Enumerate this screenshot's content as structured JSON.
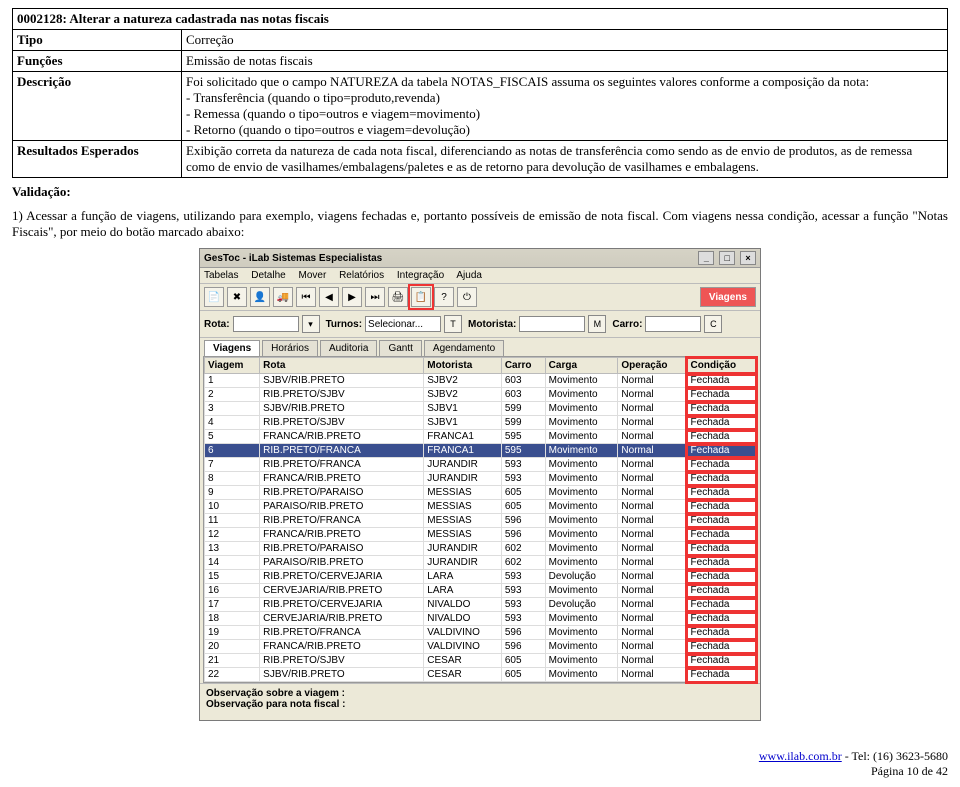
{
  "meta": {
    "titleRow": "0002128: Alterar a natureza cadastrada nas notas fiscais",
    "tipoLabel": "Tipo",
    "tipoValue": "Correção",
    "funcoesLabel": "Funções",
    "funcoesValue": "Emissão de notas fiscais",
    "descricaoLabel": "Descrição",
    "descIntro": "Foi solicitado que o campo NATUREZA da tabela NOTAS_FISCAIS assuma os seguintes valores conforme a composição da nota:",
    "descL1": "- Transferência (quando o tipo=produto,revenda)",
    "descL2": "- Remessa (quando o tipo=outros e viagem=movimento)",
    "descL3": "- Retorno (quando o tipo=outros e viagem=devolução)",
    "resultadosLabel": "Resultados Esperados",
    "resultadosValue": "Exibição correta da natureza de cada nota fiscal, diferenciando as notas de transferência como sendo as de envio de produtos, as de remessa como de envio de vasilhames/embalagens/paletes e as de retorno para devolução de vasilhames e embalagens."
  },
  "validation": {
    "head": "Validação:",
    "text": "1) Acessar a função de viagens, utilizando para exemplo, viagens fechadas e, portanto possíveis de emissão de nota fiscal. Com viagens nessa condição, acessar a função \"Notas Fiscais\", por meio do botão marcado abaixo:"
  },
  "shot": {
    "title": "GesToc - iLab Sistemas Especialistas",
    "menus": [
      "Tabelas",
      "Detalhe",
      "Mover",
      "Relatórios",
      "Integração",
      "Ajuda"
    ],
    "toolbarRight": "Viagens",
    "filters": {
      "rotaLabel": "Rota:",
      "turnosLabel": "Turnos:",
      "turnosValue": "Selecionar...",
      "motoristaLabel": "Motorista:",
      "carroLabel": "Carro:"
    },
    "tabs": [
      "Viagens",
      "Horários",
      "Auditoria",
      "Gantt",
      "Agendamento"
    ],
    "headers": [
      "Viagem",
      "Rota",
      "Motorista",
      "Carro",
      "Carga",
      "Operação",
      "Condição"
    ],
    "rows": [
      [
        "1",
        "SJBV/RIB.PRETO",
        "SJBV2",
        "603",
        "Movimento",
        "Normal",
        "Fechada"
      ],
      [
        "2",
        "RIB.PRETO/SJBV",
        "SJBV2",
        "603",
        "Movimento",
        "Normal",
        "Fechada"
      ],
      [
        "3",
        "SJBV/RIB.PRETO",
        "SJBV1",
        "599",
        "Movimento",
        "Normal",
        "Fechada"
      ],
      [
        "4",
        "RIB.PRETO/SJBV",
        "SJBV1",
        "599",
        "Movimento",
        "Normal",
        "Fechada"
      ],
      [
        "5",
        "FRANCA/RIB.PRETO",
        "FRANCA1",
        "595",
        "Movimento",
        "Normal",
        "Fechada"
      ],
      [
        "6",
        "RIB.PRETO/FRANCA",
        "FRANCA1",
        "595",
        "Movimento",
        "Normal",
        "Fechada"
      ],
      [
        "7",
        "RIB.PRETO/FRANCA",
        "JURANDIR",
        "593",
        "Movimento",
        "Normal",
        "Fechada"
      ],
      [
        "8",
        "FRANCA/RIB.PRETO",
        "JURANDIR",
        "593",
        "Movimento",
        "Normal",
        "Fechada"
      ],
      [
        "9",
        "RIB.PRETO/PARAISO",
        "MESSIAS",
        "605",
        "Movimento",
        "Normal",
        "Fechada"
      ],
      [
        "10",
        "PARAISO/RIB.PRETO",
        "MESSIAS",
        "605",
        "Movimento",
        "Normal",
        "Fechada"
      ],
      [
        "11",
        "RIB.PRETO/FRANCA",
        "MESSIAS",
        "596",
        "Movimento",
        "Normal",
        "Fechada"
      ],
      [
        "12",
        "FRANCA/RIB.PRETO",
        "MESSIAS",
        "596",
        "Movimento",
        "Normal",
        "Fechada"
      ],
      [
        "13",
        "RIB.PRETO/PARAISO",
        "JURANDIR",
        "602",
        "Movimento",
        "Normal",
        "Fechada"
      ],
      [
        "14",
        "PARAISO/RIB.PRETO",
        "JURANDIR",
        "602",
        "Movimento",
        "Normal",
        "Fechada"
      ],
      [
        "15",
        "RIB.PRETO/CERVEJARIA",
        "LARA",
        "593",
        "Devolução",
        "Normal",
        "Fechada"
      ],
      [
        "16",
        "CERVEJARIA/RIB.PRETO",
        "LARA",
        "593",
        "Movimento",
        "Normal",
        "Fechada"
      ],
      [
        "17",
        "RIB.PRETO/CERVEJARIA",
        "NIVALDO",
        "593",
        "Devolução",
        "Normal",
        "Fechada"
      ],
      [
        "18",
        "CERVEJARIA/RIB.PRETO",
        "NIVALDO",
        "593",
        "Movimento",
        "Normal",
        "Fechada"
      ],
      [
        "19",
        "RIB.PRETO/FRANCA",
        "VALDIVINO",
        "596",
        "Movimento",
        "Normal",
        "Fechada"
      ],
      [
        "20",
        "FRANCA/RIB.PRETO",
        "VALDIVINO",
        "596",
        "Movimento",
        "Normal",
        "Fechada"
      ],
      [
        "21",
        "RIB.PRETO/SJBV",
        "CESAR",
        "605",
        "Movimento",
        "Normal",
        "Fechada"
      ],
      [
        "22",
        "SJBV/RIB.PRETO",
        "CESAR",
        "605",
        "Movimento",
        "Normal",
        "Fechada"
      ]
    ],
    "selectedRow": 5,
    "obs1": "Observação sobre a viagem :",
    "obs2": "Observação para nota fiscal :"
  },
  "footer": {
    "link": "www.ilab.com.br",
    "tel": " - Tel: (16) 3623-5680",
    "page": "Página 10 de 42"
  }
}
